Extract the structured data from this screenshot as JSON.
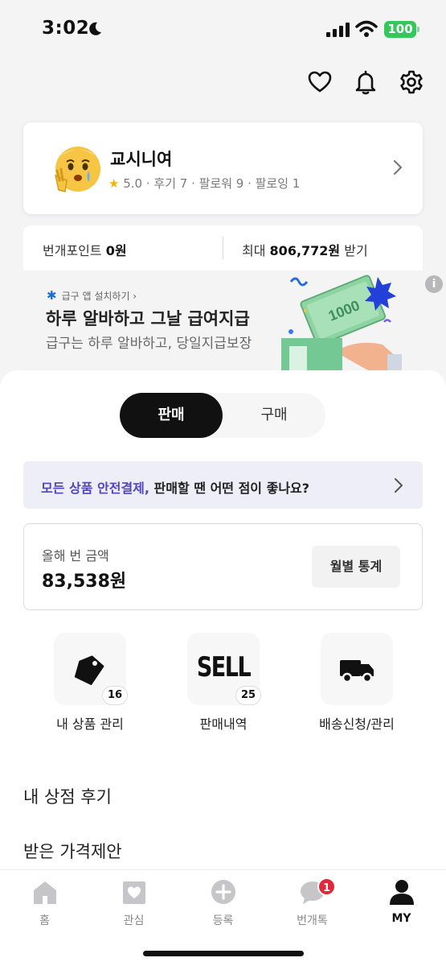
{
  "status": {
    "time": "3:02",
    "battery": "100"
  },
  "profile": {
    "name": "교시니여",
    "rating": "5.0",
    "stats_text": " · 후기 7 · 팔로워 9 · 팔로잉 1"
  },
  "points": {
    "label": "번개포인트",
    "value": "0원",
    "max_label": "최대",
    "max_value": "806,772원",
    "max_suffix": "받기"
  },
  "banner": {
    "tag": "급구 앱 설치하기 ›",
    "title": "하루 알바하고 그날 급여지급",
    "subtitle": "급구는 하루 알바하고, 당일지급보장",
    "info": "i"
  },
  "tabs": {
    "sell": "판매",
    "buy": "구매"
  },
  "safe_pay": {
    "highlight": "모든 상품 안전결제,",
    "text": " 판매할 땐 어떤 점이 좋나요?"
  },
  "earnings": {
    "label": "올해 번 금액",
    "value": "83,538원",
    "button": "월별 통계"
  },
  "menu": [
    {
      "label": "내 상품 관리",
      "badge": "16",
      "icon": "tag-icon"
    },
    {
      "label": "판매내역",
      "badge": "25",
      "icon": "sell-icon",
      "word": "SELL"
    },
    {
      "label": "배송신청/관리",
      "icon": "truck-icon"
    }
  ],
  "list": {
    "reviews": "내 상점 후기",
    "offers": "받은 가격제안"
  },
  "nav": {
    "home": "홈",
    "favorites": "관심",
    "register": "등록",
    "chat": "번개톡",
    "chat_badge": "1",
    "my": "MY"
  },
  "colors": {
    "accent": "#5046b8",
    "badge": "#e0283a",
    "battery": "#34c759"
  }
}
